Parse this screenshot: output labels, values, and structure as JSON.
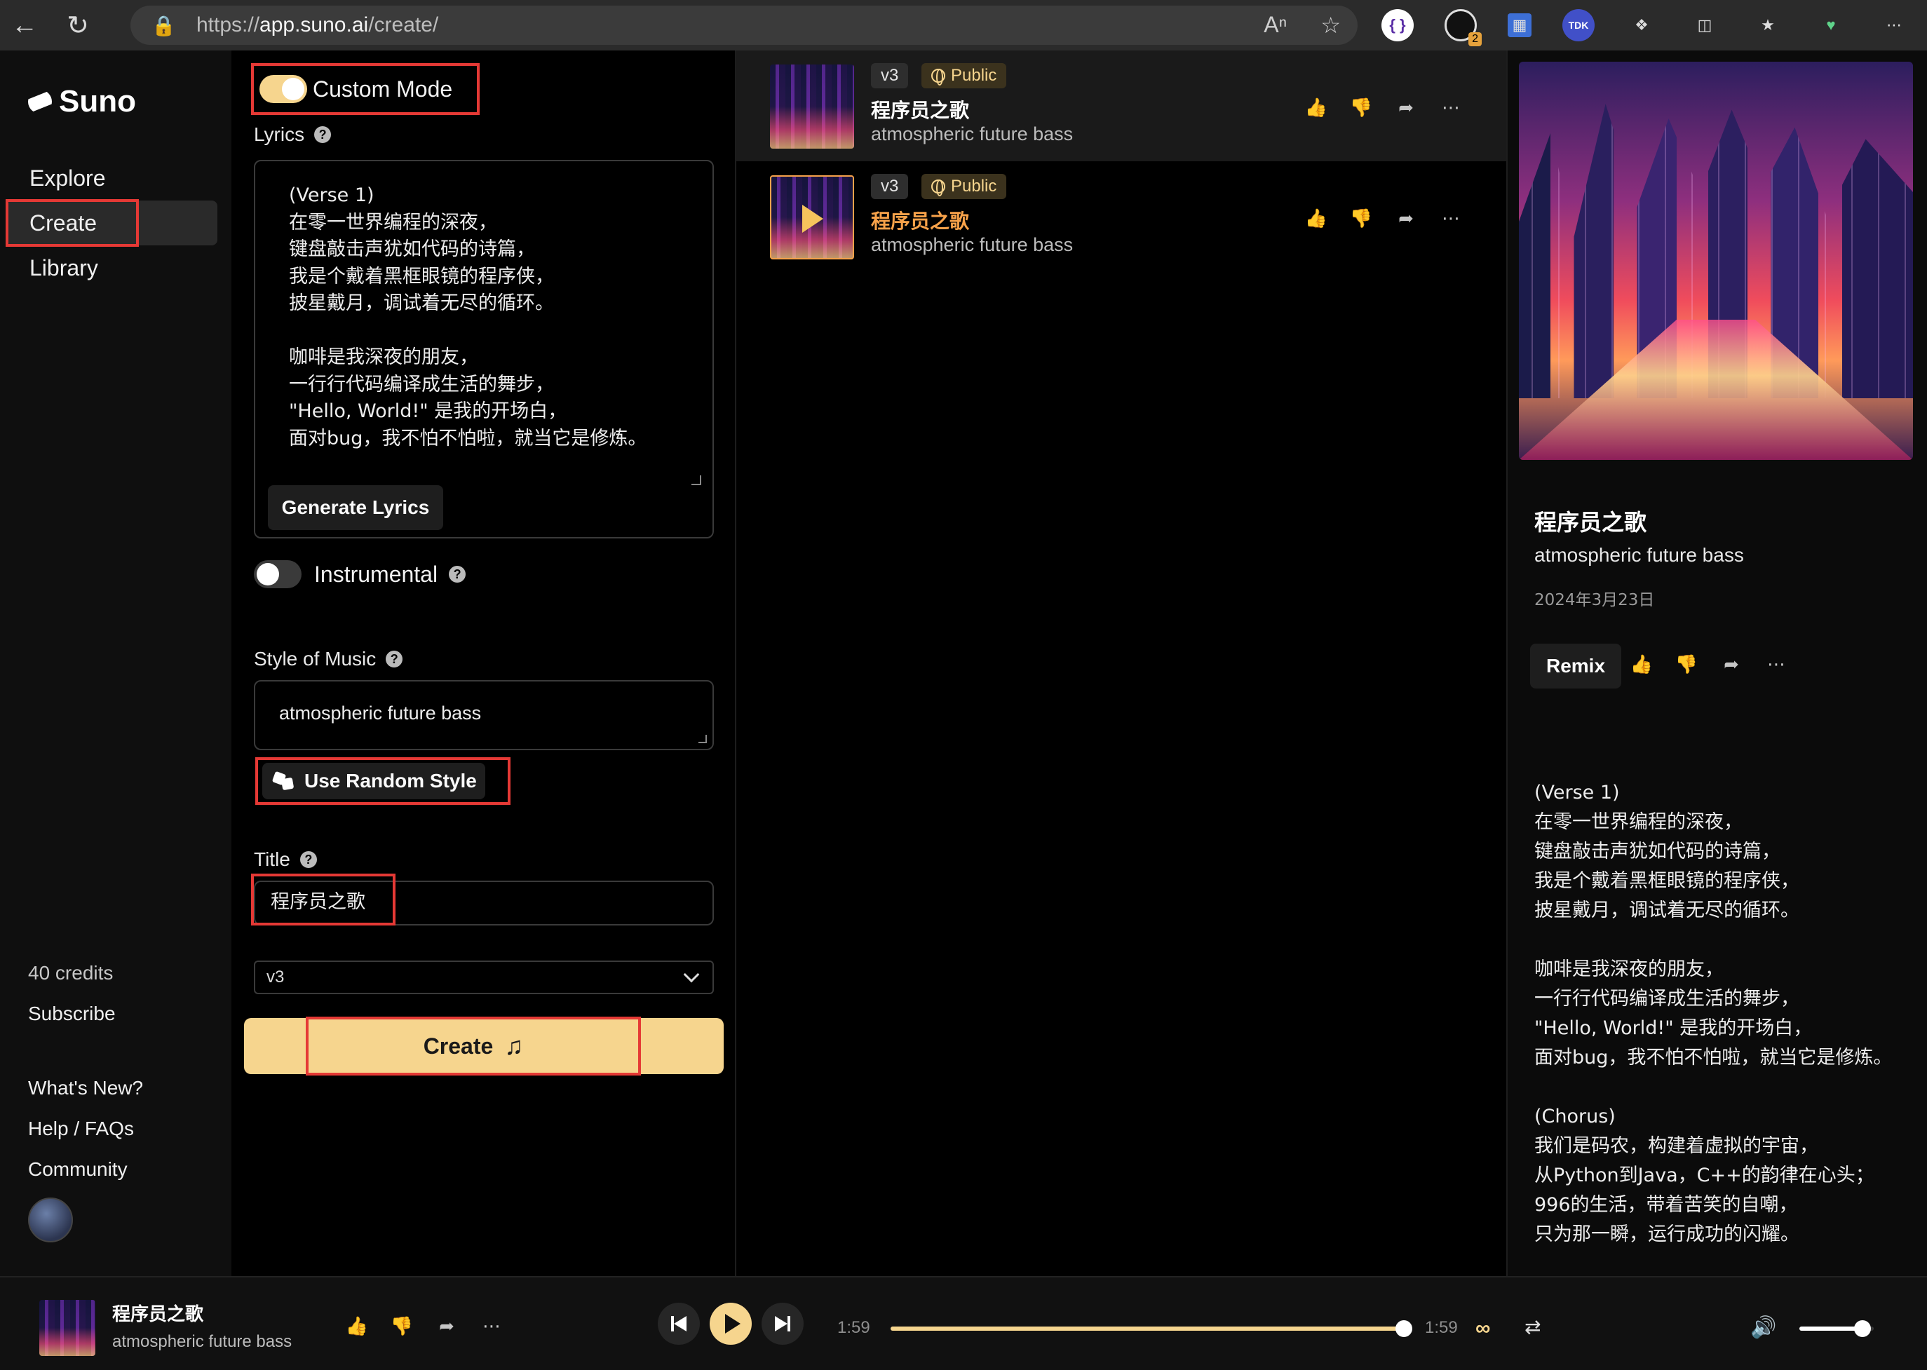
{
  "browser": {
    "url_scheme": "https://",
    "url_host": "app.suno.ai",
    "url_path": "/create/",
    "extension_badge": "2",
    "tdk_label": "TDK"
  },
  "sidebar": {
    "logo": "Suno",
    "items": [
      {
        "label": "Explore"
      },
      {
        "label": "Create"
      },
      {
        "label": "Library"
      }
    ],
    "credits": "40 credits",
    "subscribe": "Subscribe",
    "whats_new": "What's New?",
    "help": "Help / FAQs",
    "community": "Community"
  },
  "create": {
    "custom_mode_label": "Custom Mode",
    "custom_mode_on": true,
    "lyrics_label": "Lyrics",
    "lyrics": "(Verse 1)\n在零一世界编程的深夜，\n键盘敲击声犹如代码的诗篇，\n我是个戴着黑框眼镜的程序侠，\n披星戴月，调试着无尽的循环。\n\n咖啡是我深夜的朋友，\n一行行代码编译成生活的舞步，\n\"Hello, World!\" 是我的开场白，\n面对bug，我不怕不怕啦，就当它是修炼。",
    "generate_lyrics": "Generate Lyrics",
    "instrumental_label": "Instrumental",
    "instrumental_on": false,
    "style_label": "Style of Music",
    "style_value": "atmospheric future bass",
    "random_style": "Use Random Style",
    "title_label": "Title",
    "title_value": "程序员之歌",
    "model_value": "v3",
    "create_button": "Create"
  },
  "songs": [
    {
      "version": "v3",
      "visibility": "Public",
      "title": "程序员之歌",
      "style": "atmospheric future bass",
      "selected": true
    },
    {
      "version": "v3",
      "visibility": "Public",
      "title": "程序员之歌",
      "style": "atmospheric future bass",
      "selected": false,
      "playing": true
    }
  ],
  "detail": {
    "title": "程序员之歌",
    "style": "atmospheric future bass",
    "date": "2024年3月23日",
    "remix": "Remix",
    "lyrics": "(Verse 1)\n在零一世界编程的深夜，\n键盘敲击声犹如代码的诗篇，\n我是个戴着黑框眼镜的程序侠，\n披星戴月，调试着无尽的循环。\n\n咖啡是我深夜的朋友，\n一行行代码编译成生活的舞步，\n\"Hello, World!\" 是我的开场白，\n面对bug，我不怕不怕啦，就当它是修炼。\n\n(Chorus)\n我们是码农，构建着虚拟的宇宙，\n从Python到Java，C++的韵律在心头；\n996的生活，带着苦笑的自嘲，\n只为那一瞬，运行成功的闪耀。"
  },
  "player": {
    "title": "程序员之歌",
    "style": "atmospheric future bass",
    "elapsed": "1:59",
    "duration": "1:59",
    "progress_fraction": 1.0,
    "volume_fraction": 0.85
  },
  "colors": {
    "accent": "#f6d58e",
    "highlight_title": "#f7a24a",
    "annotation_box": "#e53935"
  }
}
